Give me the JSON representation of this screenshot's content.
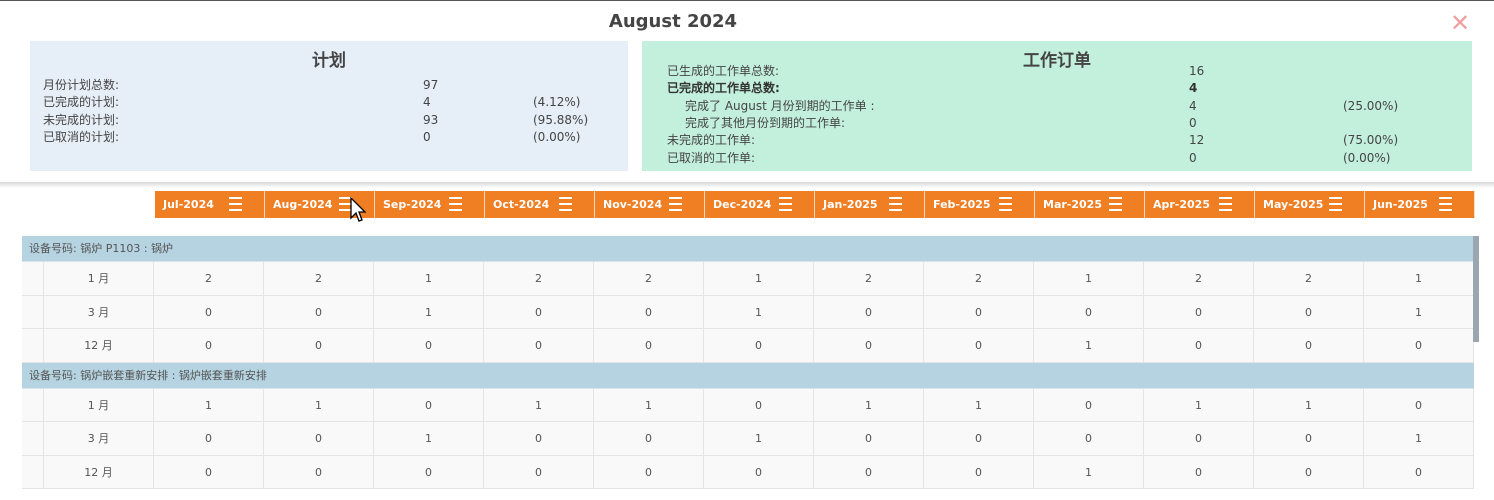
{
  "modal": {
    "title": "August 2024",
    "close_glyph": "✕"
  },
  "plan": {
    "heading": "计划",
    "rows": [
      {
        "label": "月份计划总数:",
        "value": "97",
        "pct": ""
      },
      {
        "label": "已完成的计划:",
        "value": "4",
        "pct": "(4.12%)"
      },
      {
        "label": "未完成的计划:",
        "value": "93",
        "pct": "(95.88%)"
      },
      {
        "label": "已取消的计划:",
        "value": "0",
        "pct": "(0.00%)"
      }
    ]
  },
  "workorders": {
    "heading": "工作订单",
    "rows": [
      {
        "label": "已生成的工作单总数:",
        "value": "16",
        "pct": ""
      },
      {
        "label": "已完成的工作单总数:",
        "value": "4",
        "pct": ""
      },
      {
        "label": "完成了 August 月份到期的工作单 :",
        "value": "4",
        "pct": "(25.00%)"
      },
      {
        "label": "完成了其他月份到期的工作单:",
        "value": "0",
        "pct": ""
      },
      {
        "label": "未完成的工作单:",
        "value": "12",
        "pct": "(75.00%)"
      },
      {
        "label": "已取消的工作单:",
        "value": "0",
        "pct": "(0.00%)"
      }
    ]
  },
  "months": [
    "Jul-2024",
    "Aug-2024",
    "Sep-2024",
    "Oct-2024",
    "Nov-2024",
    "Dec-2024",
    "Jan-2025",
    "Feb-2025",
    "Mar-2025",
    "Apr-2025",
    "May-2025",
    "Jun-2025"
  ],
  "groups": [
    {
      "title": "设备号码: 锅炉 P1103 : 锅炉",
      "rows": [
        {
          "label": "1 月",
          "values": [
            "2",
            "2",
            "1",
            "2",
            "2",
            "1",
            "2",
            "2",
            "1",
            "2",
            "2",
            "1"
          ]
        },
        {
          "label": "3 月",
          "values": [
            "0",
            "0",
            "1",
            "0",
            "0",
            "1",
            "0",
            "0",
            "0",
            "0",
            "0",
            "1"
          ]
        },
        {
          "label": "12 月",
          "values": [
            "0",
            "0",
            "0",
            "0",
            "0",
            "0",
            "0",
            "0",
            "1",
            "0",
            "0",
            "0"
          ]
        }
      ]
    },
    {
      "title": "设备号码: 锅炉嵌套重新安排 : 锅炉嵌套重新安排",
      "rows": [
        {
          "label": "1 月",
          "values": [
            "1",
            "1",
            "0",
            "1",
            "1",
            "0",
            "1",
            "1",
            "0",
            "1",
            "1",
            "0"
          ]
        },
        {
          "label": "3 月",
          "values": [
            "0",
            "0",
            "1",
            "0",
            "0",
            "1",
            "0",
            "0",
            "0",
            "0",
            "0",
            "1"
          ]
        },
        {
          "label": "12 月",
          "values": [
            "0",
            "0",
            "0",
            "0",
            "0",
            "0",
            "0",
            "0",
            "1",
            "0",
            "0",
            "0"
          ]
        }
      ]
    }
  ],
  "colors": {
    "month_header": "#f07e23",
    "group_row": "#b5d3e1",
    "plan_panel": "#e6eef7",
    "wo_panel": "#c3efdd"
  },
  "icons": {
    "close": "close-icon",
    "month_menu": "hamburger-menu-icon",
    "cursor": "mouse-pointer-icon"
  }
}
